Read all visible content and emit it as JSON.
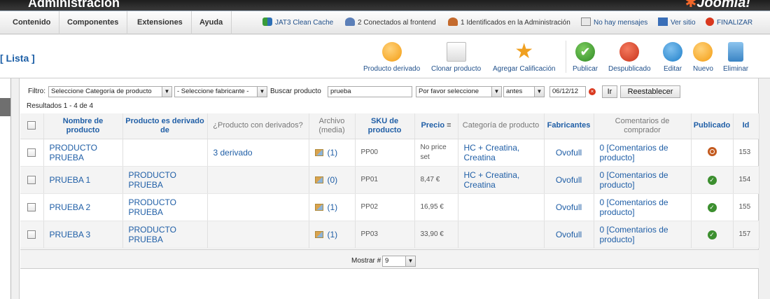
{
  "header": {
    "title": "Administración",
    "brand": "Joomla!"
  },
  "menu": [
    {
      "label": "Contenido"
    },
    {
      "label": "Componentes"
    },
    {
      "label": "Extensiones"
    },
    {
      "label": "Ayuda"
    }
  ],
  "status": {
    "cache": "JAT3 Clean Cache",
    "frontend": "2 Conectados al frontend",
    "admin": "1 Identificados en la Administración",
    "messages": "No hay mensajes",
    "site": "Ver sitio",
    "logout": "FINALIZAR"
  },
  "page_title": "[ Lista ]",
  "toolbar": {
    "derived": "Producto derivado",
    "clone": "Clonar producto",
    "rating": "Agregar Calificación",
    "publish": "Publicar",
    "unpublish": "Despublicado",
    "edit": "Editar",
    "new": "Nuevo",
    "delete": "Eliminar"
  },
  "filter": {
    "label": "Filtro:",
    "category": "Seleccione Categoría de producto",
    "manufacturer": "- Seleccione fabricante -",
    "search_label": "Buscar producto",
    "search_value": "prueba",
    "option": "Por favor seleccione",
    "when": "antes",
    "date": "06/12/12",
    "go": "Ir",
    "reset": "Reestablecer"
  },
  "results": "Resultados 1 - 4 de 4",
  "columns": {
    "name": "Nombre de producto",
    "derived_of": "Producto es derivado de",
    "has_derived": "¿Producto con derivados?",
    "media": "Archivo (media)",
    "sku": "SKU de producto",
    "price": "Precio",
    "category": "Categoría de producto",
    "manufacturers": "Fabricantes",
    "comments": "Comentarios de comprador",
    "published": "Publicado",
    "id": "Id"
  },
  "rows": [
    {
      "name": "PRODUCTO PRUEBA",
      "parent": "",
      "derived": "3 derivado",
      "media": "(1)",
      "sku": "PP00",
      "price": "No price set",
      "category": "HC + Creatina, Creatina",
      "manufacturer": "Ovofull",
      "comments": "0 [Comentarios de producto]",
      "published": false,
      "id": "153"
    },
    {
      "name": "PRUEBA 1",
      "parent": "PRODUCTO PRUEBA",
      "derived": "",
      "media": "(0)",
      "sku": "PP01",
      "price": "8,47 €",
      "category": "HC + Creatina, Creatina",
      "manufacturer": "Ovofull",
      "comments": "0 [Comentarios de producto]",
      "published": true,
      "id": "154"
    },
    {
      "name": "PRUEBA 2",
      "parent": "PRODUCTO PRUEBA",
      "derived": "",
      "media": "(1)",
      "sku": "PP02",
      "price": "16,95 €",
      "category": "",
      "manufacturer": "Ovofull",
      "comments": "0 [Comentarios de producto]",
      "published": true,
      "id": "155"
    },
    {
      "name": "PRUEBA 3",
      "parent": "PRODUCTO PRUEBA",
      "derived": "",
      "media": "(1)",
      "sku": "PP03",
      "price": "33,90 €",
      "category": "",
      "manufacturer": "Ovofull",
      "comments": "0 [Comentarios de producto]",
      "published": true,
      "id": "157"
    }
  ],
  "footer": {
    "show_label": "Mostrar #",
    "show_value": "9"
  },
  "colors": {
    "link": "#1f5ea6",
    "ok": "#3c8f2f",
    "orange": "#f5a623",
    "red": "#d9381e",
    "blue": "#2a8fd8"
  }
}
